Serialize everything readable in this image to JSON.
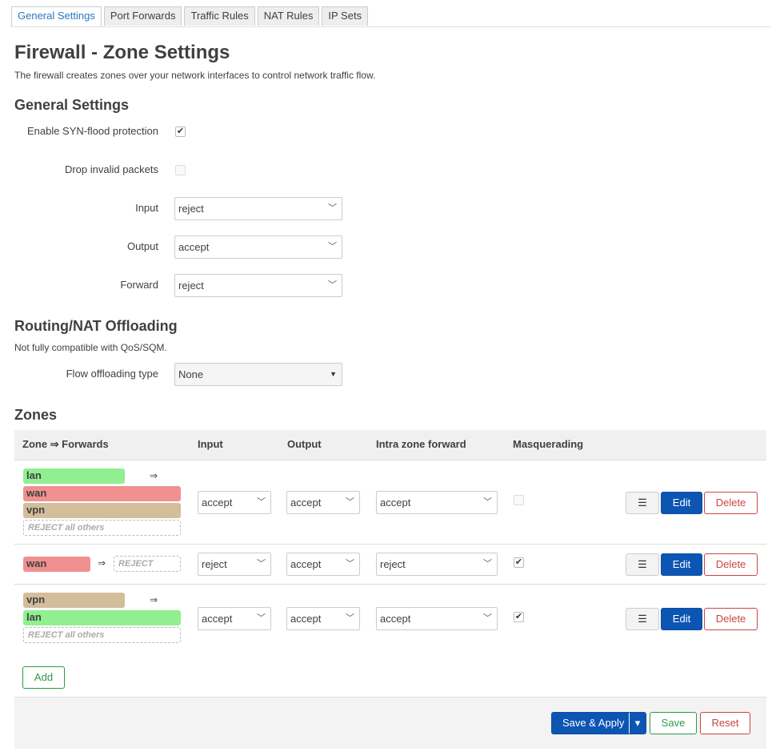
{
  "tabs": [
    "General Settings",
    "Port Forwards",
    "Traffic Rules",
    "NAT Rules",
    "IP Sets"
  ],
  "page": {
    "title": "Firewall - Zone Settings",
    "description": "The firewall creates zones over your network interfaces to control network traffic flow."
  },
  "general": {
    "heading": "General Settings",
    "syn_flood_label": "Enable SYN-flood protection",
    "syn_flood_checked": true,
    "drop_invalid_label": "Drop invalid packets",
    "drop_invalid_checked": false,
    "input_label": "Input",
    "input_value": "reject",
    "output_label": "Output",
    "output_value": "accept",
    "forward_label": "Forward",
    "forward_value": "reject"
  },
  "offload": {
    "heading": "Routing/NAT Offloading",
    "note": "Not fully compatible with QoS/SQM.",
    "type_label": "Flow offloading type",
    "type_value": "None"
  },
  "zones": {
    "heading": "Zones",
    "columns": {
      "zone_forwards": "Zone ⇒ Forwards",
      "input": "Input",
      "output": "Output",
      "intra": "Intra zone forward",
      "masq": "Masquerading"
    },
    "rows": [
      {
        "zone": "lan",
        "forwards": [
          "wan",
          "vpn"
        ],
        "reject_text": "REJECT all others",
        "input": "accept",
        "output": "accept",
        "intra": "accept",
        "masq": false
      },
      {
        "zone": "wan",
        "forwards": [],
        "reject_text": "REJECT",
        "input": "reject",
        "output": "accept",
        "intra": "reject",
        "masq": true
      },
      {
        "zone": "vpn",
        "forwards": [
          "lan"
        ],
        "reject_text": "REJECT all others",
        "input": "accept",
        "output": "accept",
        "intra": "accept",
        "masq": true
      }
    ],
    "arrow": "⇒",
    "menu_icon": "☰",
    "edit_label": "Edit",
    "delete_label": "Delete",
    "add_label": "Add"
  },
  "footer": {
    "save_apply_label": "Save & Apply",
    "dropdown_icon": "▾",
    "save_label": "Save",
    "reset_label": "Reset"
  },
  "colors": {
    "lan": "#90f090",
    "wan": "#f09090",
    "vpn": "#d3bd9b",
    "primary": "#0d55b3",
    "positive": "#2a9a4a",
    "negative": "#cc4444"
  }
}
